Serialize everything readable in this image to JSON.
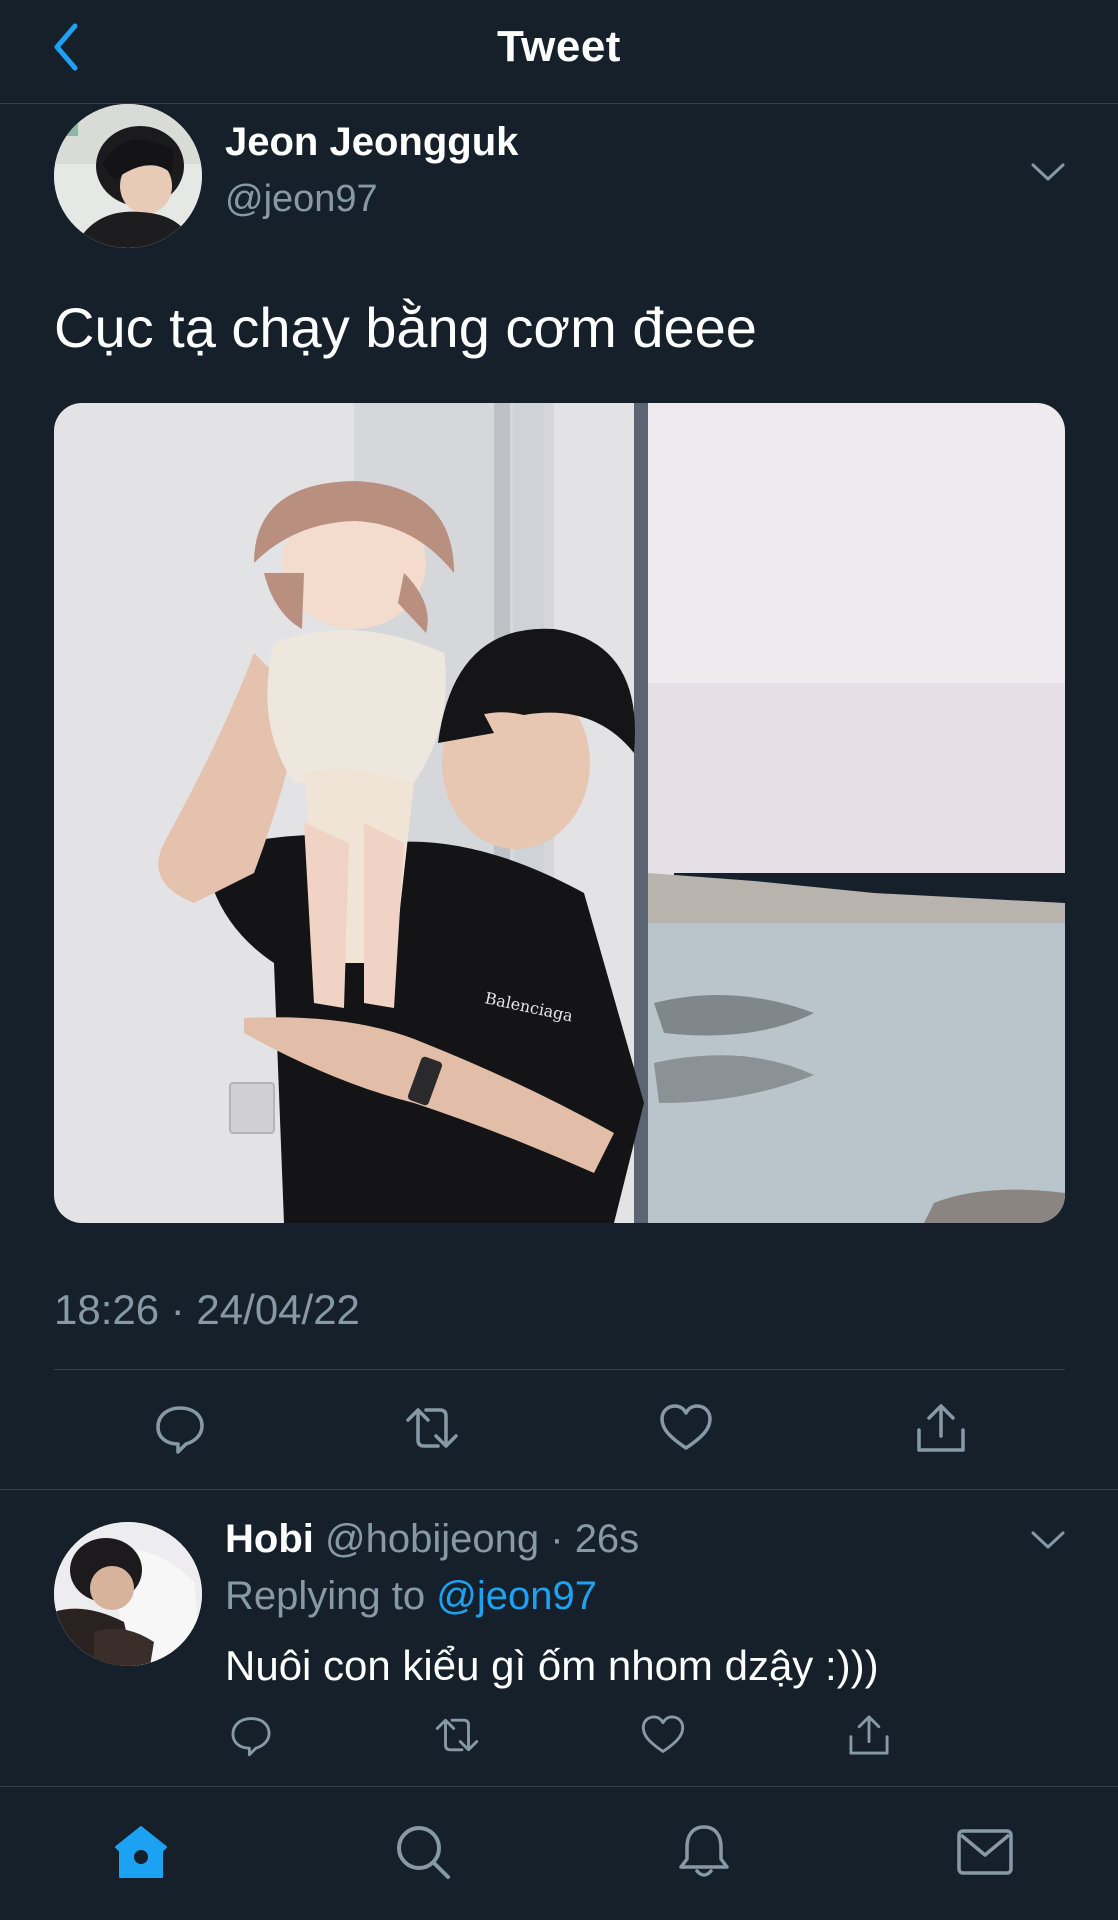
{
  "header": {
    "title": "Tweet",
    "back_icon": "chevron-left-icon"
  },
  "tweet": {
    "author_name": "Jeon Jeongguk",
    "author_handle": "@jeon97",
    "text": "Cục tạ chạy bằng cơm đeee",
    "timestamp": "18:26 · 24/04/22",
    "media_label": "Photo of a man holding a baby in front of a window",
    "logo_text": "Balenciaga"
  },
  "reply": {
    "author_name": "Hobi",
    "author_handle": "@hobijeong",
    "separator": "·",
    "age": "26s",
    "replying_prefix": "Replying to ",
    "replying_to": "@jeon97",
    "text": "Nuôi con kiểu gì ốm nhom dzậy :)))"
  },
  "icons": {
    "reply": "reply-icon",
    "retweet": "retweet-icon",
    "like": "heart-icon",
    "share": "share-icon",
    "more": "chevron-down-icon"
  },
  "tabs": [
    {
      "name": "home",
      "icon": "home-icon",
      "active": true
    },
    {
      "name": "search",
      "icon": "search-icon",
      "active": false
    },
    {
      "name": "notifications",
      "icon": "bell-icon",
      "active": false
    },
    {
      "name": "messages",
      "icon": "mail-icon",
      "active": false
    }
  ],
  "colors": {
    "background": "#15202b",
    "accent": "#1da1f2",
    "secondary_text": "#8899a6",
    "border": "#38444d"
  }
}
